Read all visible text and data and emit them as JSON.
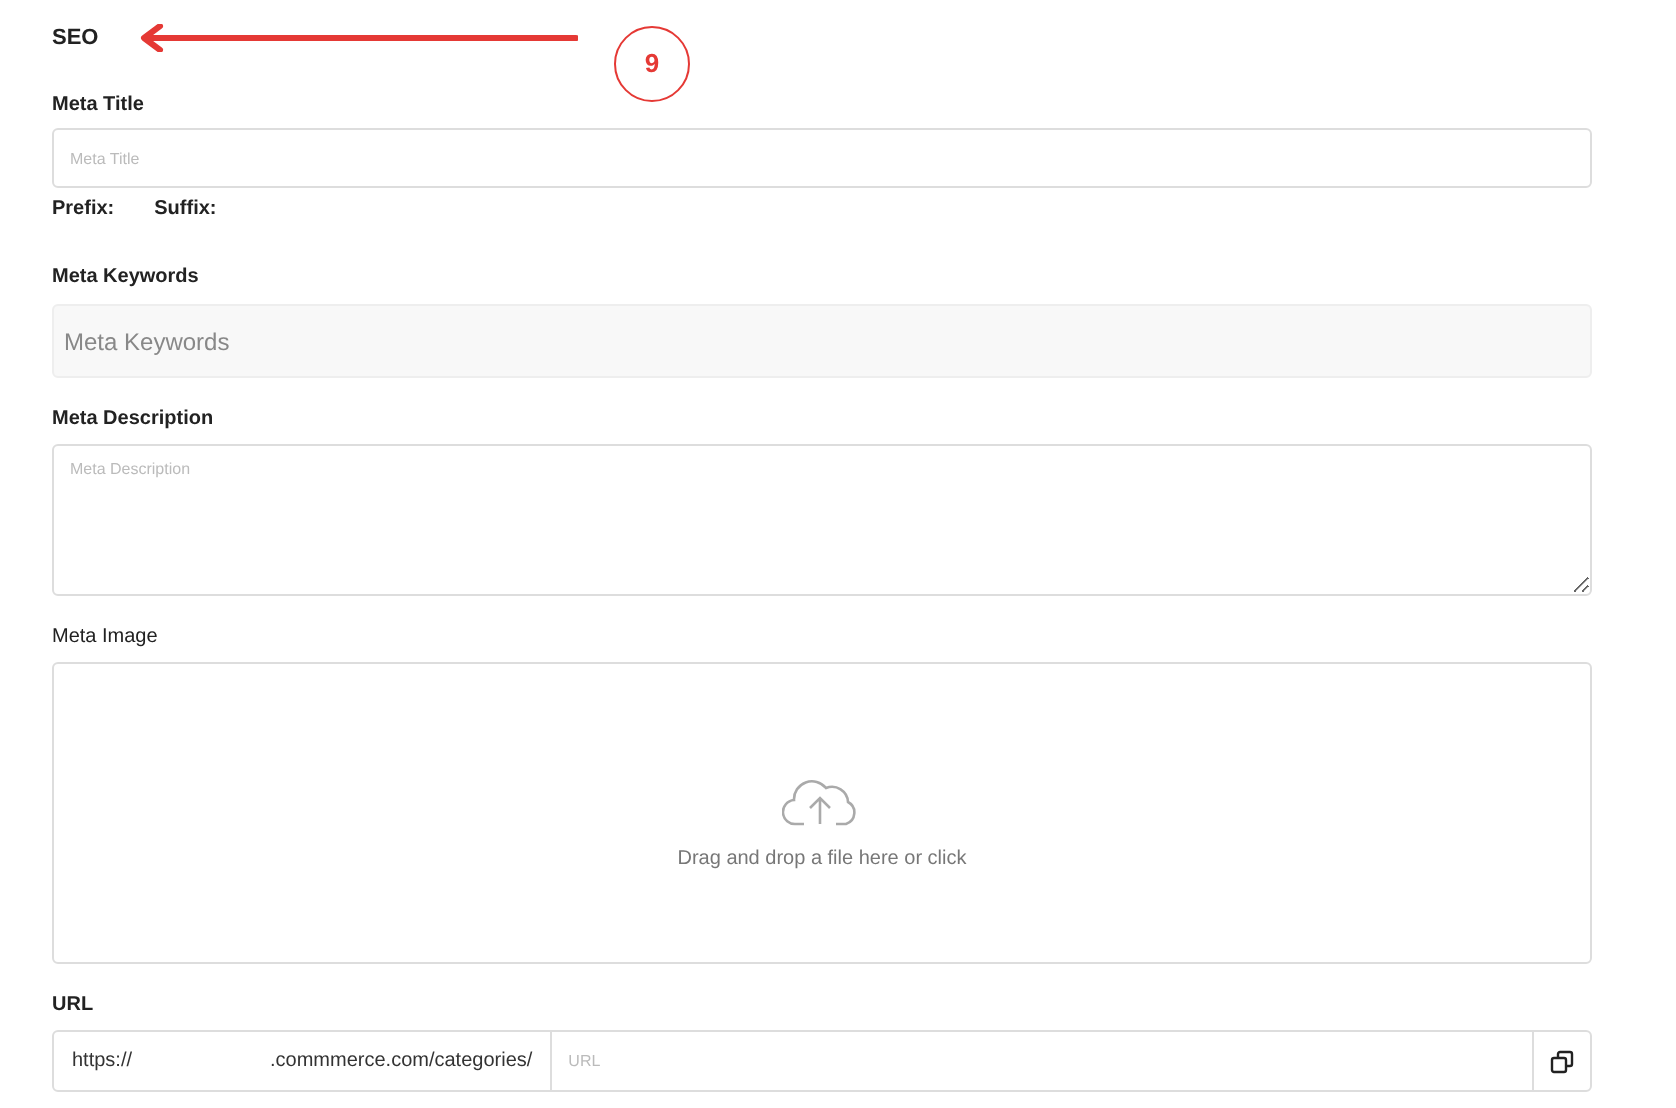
{
  "section_title": "SEO",
  "annotation": {
    "number": "9"
  },
  "meta_title": {
    "label": "Meta Title",
    "placeholder": "Meta Title"
  },
  "affixes": [
    "Prefix:",
    "Suffix:"
  ],
  "meta_keywords": {
    "label": "Meta Keywords",
    "placeholder": "Meta Keywords"
  },
  "meta_description": {
    "label": "Meta Description",
    "placeholder": "Meta Description"
  },
  "meta_image": {
    "label": "Meta Image",
    "dropzone_text": "Drag and drop a file here or click"
  },
  "url": {
    "label": "URL",
    "prefix_start": "https://",
    "prefix_end": ".commmerce.com/categories/",
    "placeholder": "URL"
  }
}
